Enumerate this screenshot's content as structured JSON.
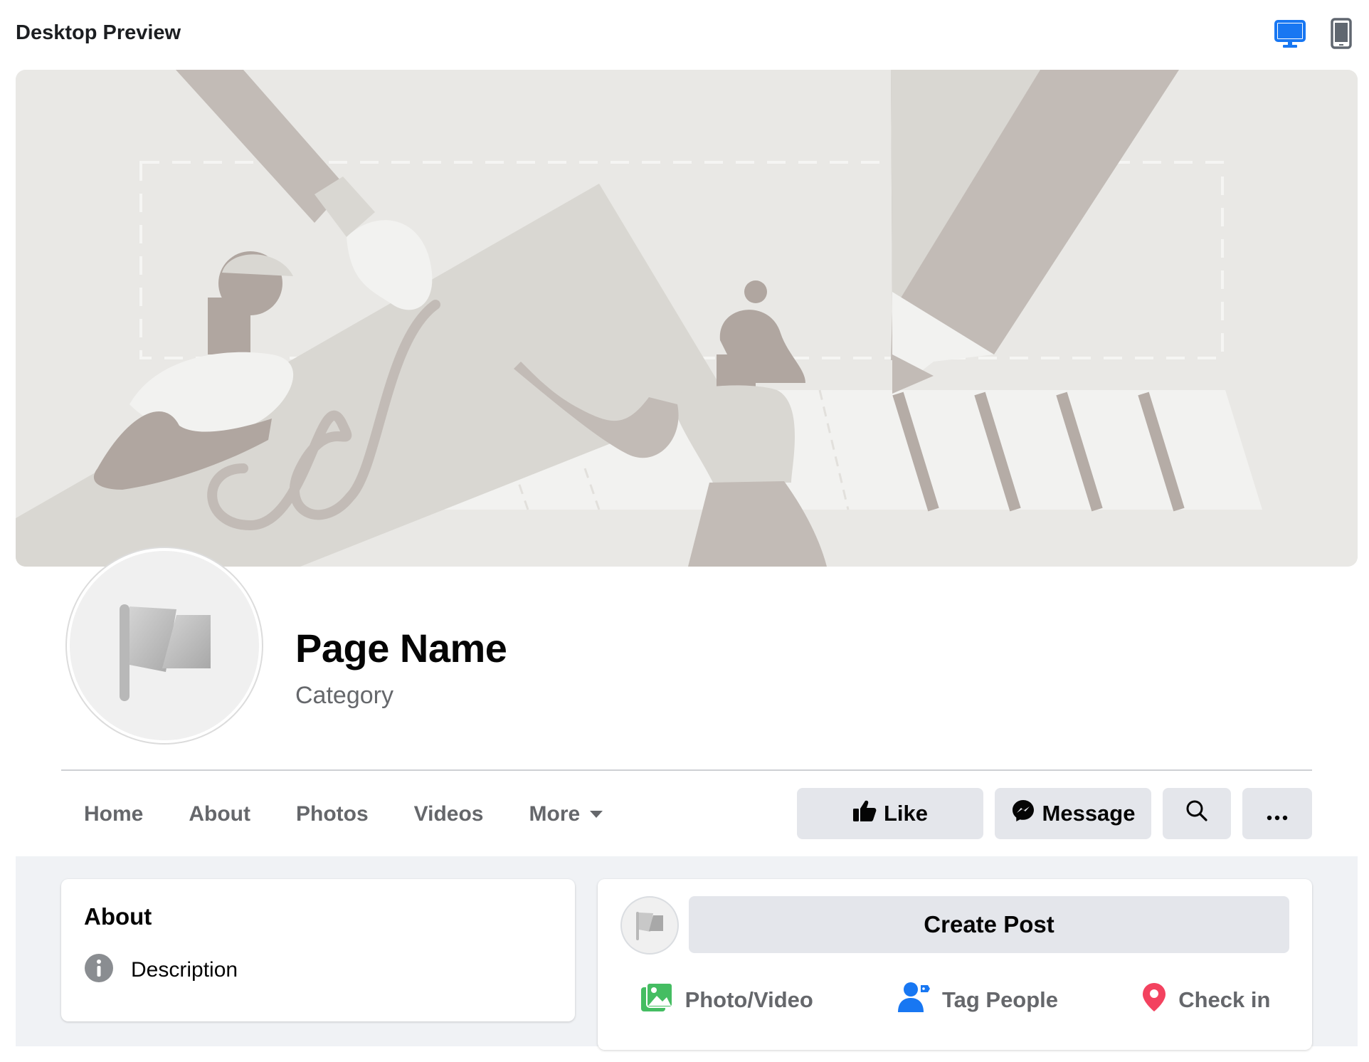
{
  "header": {
    "title": "Desktop Preview",
    "desktop_icon": "desktop-monitor-icon",
    "mobile_icon": "mobile-phone-icon",
    "active_color": "#1877f2",
    "inactive_color": "#606770"
  },
  "cover": {
    "illustration": "people-with-paintbrush-and-pencil-illustration",
    "bg_color": "#e9e8e5"
  },
  "profile": {
    "page_name": "Page Name",
    "category": "Category",
    "avatar_icon": "flag-icon"
  },
  "nav": {
    "items": [
      "Home",
      "About",
      "Photos",
      "Videos",
      "More"
    ]
  },
  "actions": {
    "like_label": "Like",
    "message_label": "Message",
    "search_icon": "search-icon",
    "more_icon": "ellipsis-icon"
  },
  "about": {
    "title": "About",
    "description": "Description",
    "info_icon": "info-icon"
  },
  "composer": {
    "create_post_label": "Create Post",
    "photo_video_label": "Photo/Video",
    "tag_people_label": "Tag People",
    "check_in_label": "Check in",
    "photo_color": "#45bd62",
    "tag_color": "#1877f2",
    "checkin_color": "#f3425f"
  }
}
